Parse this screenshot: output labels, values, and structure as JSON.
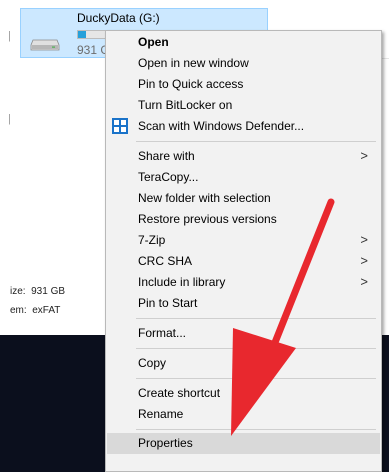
{
  "drive": {
    "name": "DuckyData (G:)",
    "size_text": "931 G",
    "usage_fraction": 0.05
  },
  "details": {
    "size_label": "ize:",
    "size_value": "931 GB",
    "fs_label": "em:",
    "fs_value": "exFAT"
  },
  "context_menu": {
    "items": [
      {
        "label": "Open",
        "bold": true
      },
      {
        "label": "Open in new window"
      },
      {
        "label": "Pin to Quick access"
      },
      {
        "label": "Turn BitLocker on"
      },
      {
        "label": "Scan with Windows Defender...",
        "icon": "windows-defender-shield-icon"
      },
      {
        "label": "Share with",
        "submenu": true
      },
      {
        "label": "TeraCopy..."
      },
      {
        "label": "New folder with selection"
      },
      {
        "label": "Restore previous versions"
      },
      {
        "label": "7-Zip",
        "submenu": true
      },
      {
        "label": "CRC SHA",
        "submenu": true
      },
      {
        "label": "Include in library",
        "submenu": true
      },
      {
        "label": "Pin to Start"
      },
      {
        "label": "Format..."
      },
      {
        "label": "Copy"
      },
      {
        "label": "Create shortcut"
      },
      {
        "label": "Rename"
      },
      {
        "label": "Properties",
        "highlighted": true
      }
    ],
    "submenu_glyph": ">"
  },
  "annotation": {
    "arrow_color": "#e8282e",
    "arrow_target": "Properties"
  },
  "colors": {
    "selection_fill": "#cce8ff",
    "selection_border": "#99d1ff",
    "menu_background": "#f2f2f2",
    "highlight": "#d9d9d9",
    "dark_band": "#0b0f1d"
  }
}
